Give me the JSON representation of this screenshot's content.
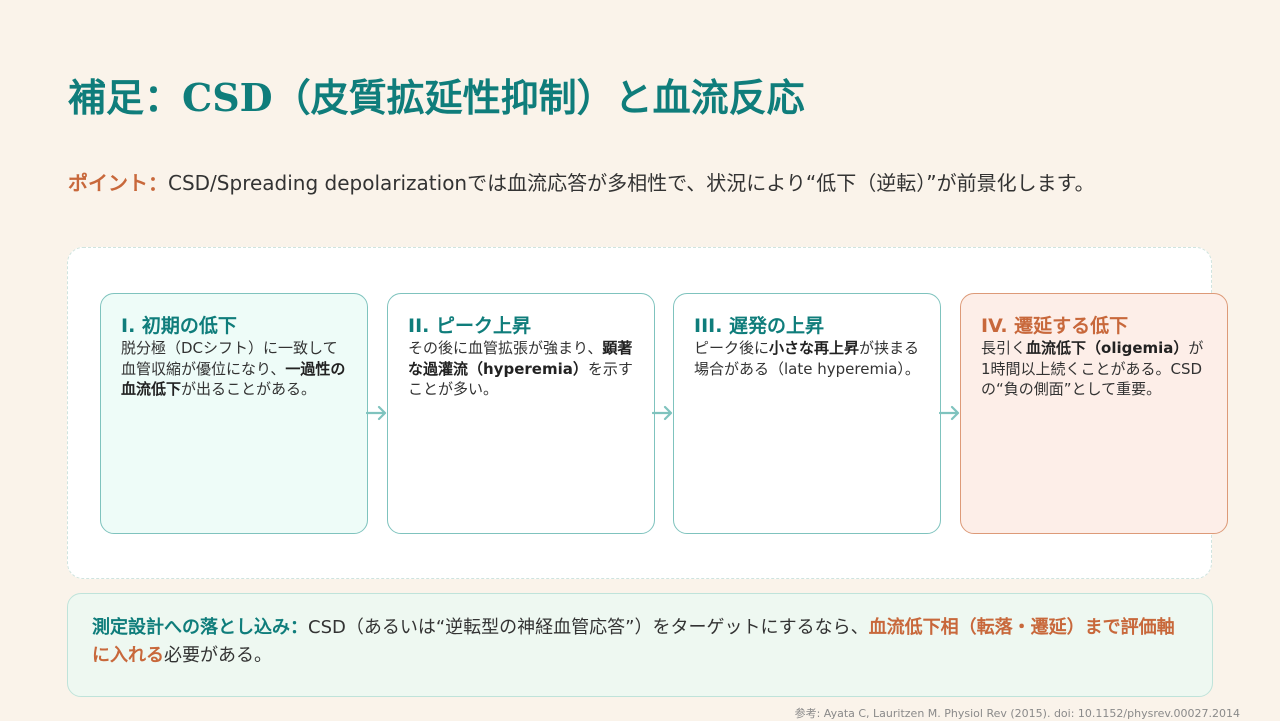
{
  "title": "補足：CSD（皮質拡延性抑制）と血流反応",
  "point": {
    "label": "ポイント：",
    "text": "CSD/Spreading depolarizationでは血流応答が多相性で、状況により“低下（逆転）”が前景化します。"
  },
  "phases": [
    {
      "title": "I. 初期の低下",
      "body_1": "脱分極（DCシフト）に一致して血管収縮が優位になり、",
      "body_bold_1": "一過性の血流低下",
      "body_2": "が出ることがある。"
    },
    {
      "title": "II. ピーク上昇",
      "body_1": "その後に血管拡張が強まり、",
      "body_bold_1": "顕著な過灌流（hyperemia）",
      "body_2": "を示すことが多い。"
    },
    {
      "title": "III. 遅発の上昇",
      "body_1": "ピーク後に",
      "body_bold_1": "小さな再上昇",
      "body_2": "が挟まる場合がある（late hyperemia）。"
    },
    {
      "title": "IV. 遷延する低下",
      "body_1": "長引く",
      "body_bold_1": "血流低下（oligemia）",
      "body_2": "が1時間以上続くことがある。CSDの“負の側面”として重要。"
    }
  ],
  "note": {
    "label": "測定設計への落とし込み：",
    "text": "CSD（あるいは“逆転型の神経血管応答”）をターゲットにするなら、",
    "highlight": "血流低下相（転落・遷延）まで評価軸に入れる",
    "tail": "必要がある。"
  },
  "reference": "参考: Ayata C, Lauritzen M. Physiol Rev (2015). doi: 10.1152/physrev.00027.2014",
  "colors": {
    "accent": "#0f7d7b",
    "highlight": "#c8683b",
    "background": "#faf3ea"
  }
}
